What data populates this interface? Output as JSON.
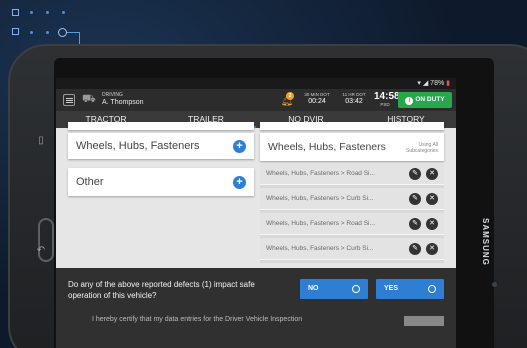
{
  "status_bar": {
    "battery": "78%"
  },
  "app_bar": {
    "driving_label": "DRIVING",
    "driver_name": "A. Thompson",
    "notification_count": "2",
    "timers": [
      {
        "label": "30 MIN DOT",
        "value": "00:24"
      },
      {
        "label": "11 HR DOT",
        "value": "03:42"
      }
    ],
    "clock": {
      "time": "14:58",
      "zone": "PSD"
    },
    "duty_status": "ON DUTY"
  },
  "tabs": [
    {
      "label": "TRACTOR",
      "active": false
    },
    {
      "label": "TRAILER",
      "active": true
    },
    {
      "label": "NO DVIR",
      "active": false
    },
    {
      "label": "HISTORY",
      "active": false
    }
  ],
  "left_categories": [
    {
      "label": "Wheels, Hubs, Fasteners"
    },
    {
      "label": "Other"
    }
  ],
  "right_header": {
    "label": "Wheels, Hubs, Fasteners",
    "sub_line1": "Using All",
    "sub_line2": "Subcategories"
  },
  "defect_items": [
    {
      "text": "Wheels, Hubs, Fasteners > Road Si..."
    },
    {
      "text": "Wheels, Hubs, Fasteners > Curb Si..."
    },
    {
      "text": "Wheels, Hubs, Fasteners > Road Si..."
    },
    {
      "text": "Wheels, Hubs, Fasteners > Curb Si..."
    }
  ],
  "question": "Do any of the above reported defects (1) impact safe operation of this vehicle?",
  "answers": {
    "no": "NO",
    "yes": "YES"
  },
  "certify_text": "I hereby certify that my data entries for the Driver Vehicle Inspection",
  "device_brand": "SAMSUNG",
  "colors": {
    "accent": "#2e7fd4",
    "on_duty": "#27a84a",
    "badge": "#f0a020"
  }
}
